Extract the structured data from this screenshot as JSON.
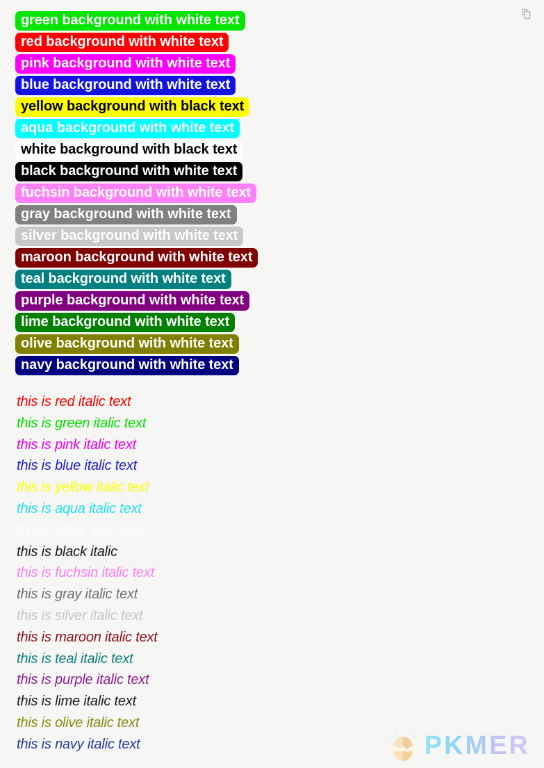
{
  "page": {
    "background_color": "#f6f6f4"
  },
  "toolbar": {
    "copy_icon": "copy-icon"
  },
  "highlights": [
    {
      "label": "green background with white text",
      "bg": "#00e500",
      "fg": "#ffffff"
    },
    {
      "label": "red background with white text",
      "bg": "#ff0000",
      "fg": "#ffffff"
    },
    {
      "label": "pink background with white text",
      "bg": "#ff00ff",
      "fg": "#ffffff"
    },
    {
      "label": "blue background with white text",
      "bg": "#1414e0",
      "fg": "#ffffff"
    },
    {
      "label": "yellow background with black text",
      "bg": "#ffff00",
      "fg": "#000000"
    },
    {
      "label": "aqua background with white text",
      "bg": "#00ffff",
      "fg": "#ffffff"
    },
    {
      "label": "white background with black text",
      "bg": "#ffffff",
      "fg": "#000000"
    },
    {
      "label": "black background with white text",
      "bg": "#000000",
      "fg": "#ffffff"
    },
    {
      "label": "fuchsin background with white text",
      "bg": "#ff80f8",
      "fg": "#ffffff"
    },
    {
      "label": "gray background with white text",
      "bg": "#808080",
      "fg": "#ffffff"
    },
    {
      "label": "silver background with white text",
      "bg": "#c8c8c8",
      "fg": "#ffffff"
    },
    {
      "label": "maroon background with white text",
      "bg": "#800000",
      "fg": "#ffffff"
    },
    {
      "label": "teal background with white text",
      "bg": "#008080",
      "fg": "#ffffff"
    },
    {
      "label": "purple background with white text",
      "bg": "#800080",
      "fg": "#ffffff"
    },
    {
      "label": "lime background with white text",
      "bg": "#008000",
      "fg": "#ffffff"
    },
    {
      "label": "olive background with white text",
      "bg": "#808000",
      "fg": "#ffffff"
    },
    {
      "label": "navy background with white text",
      "bg": "#000080",
      "fg": "#ffffff"
    }
  ],
  "italics": [
    {
      "label": "this is red italic text",
      "color": "#ff0000"
    },
    {
      "label": "this is green italic text",
      "color": "#00e000"
    },
    {
      "label": "this is pink italic text",
      "color": "#ee00ee"
    },
    {
      "label": "this is blue italic text",
      "color": "#2020cc"
    },
    {
      "label": "this is yellow italic text",
      "color": "#ffff00"
    },
    {
      "label": "this is aqua italic text",
      "color": "#22e0ee"
    },
    {
      "label": "this is white italic text",
      "color": "#fdfdfd"
    },
    {
      "label": "this is black italic",
      "color": "#1a1a1a"
    },
    {
      "label": "this is fuchsin italic text",
      "color": "#ff80f8"
    },
    {
      "label": "this is gray italic text",
      "color": "#707070"
    },
    {
      "label": "this is silver italic text",
      "color": "#c6c6c6"
    },
    {
      "label": "this is maroon italic text",
      "color": "#8a1018"
    },
    {
      "label": "this is teal italic text",
      "color": "#0e8080"
    },
    {
      "label": "this is purple italic text",
      "color": "#8c2090"
    },
    {
      "label": "this is lime italic text",
      "color": "#1a1a1a"
    },
    {
      "label": "this is olive italic text",
      "color": "#8a8a12"
    },
    {
      "label": "this is navy italic text",
      "color": "#2a3a9a"
    }
  ],
  "branding": {
    "name": "PKMER",
    "mark": "egg-logo-icon",
    "gradient_start": "#8fe4fb",
    "gradient_end": "#d3c2f2"
  }
}
